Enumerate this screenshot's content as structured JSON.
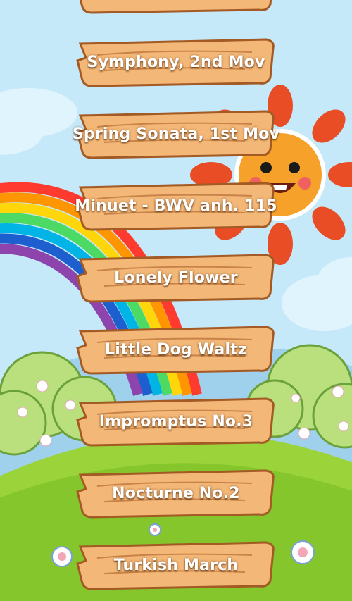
{
  "songs": [
    {
      "label": ""
    },
    {
      "label": "Symphony, 2nd Mov"
    },
    {
      "label": "Spring Sonata, 1st Mov"
    },
    {
      "label": "Minuet - BWV anh. 115"
    },
    {
      "label": "Lonely Flower"
    },
    {
      "label": "Little Dog Waltz"
    },
    {
      "label": "Impromptus No.3"
    },
    {
      "label": "Nocturne No.2"
    },
    {
      "label": "Turkish March"
    }
  ],
  "colors": {
    "sky": "#bfe6f8",
    "grass": "#8fcf2f",
    "wood": "#f3b777",
    "wood_edge": "#a35a24",
    "sun": "#f58a2a",
    "petal": "#e84d25"
  }
}
